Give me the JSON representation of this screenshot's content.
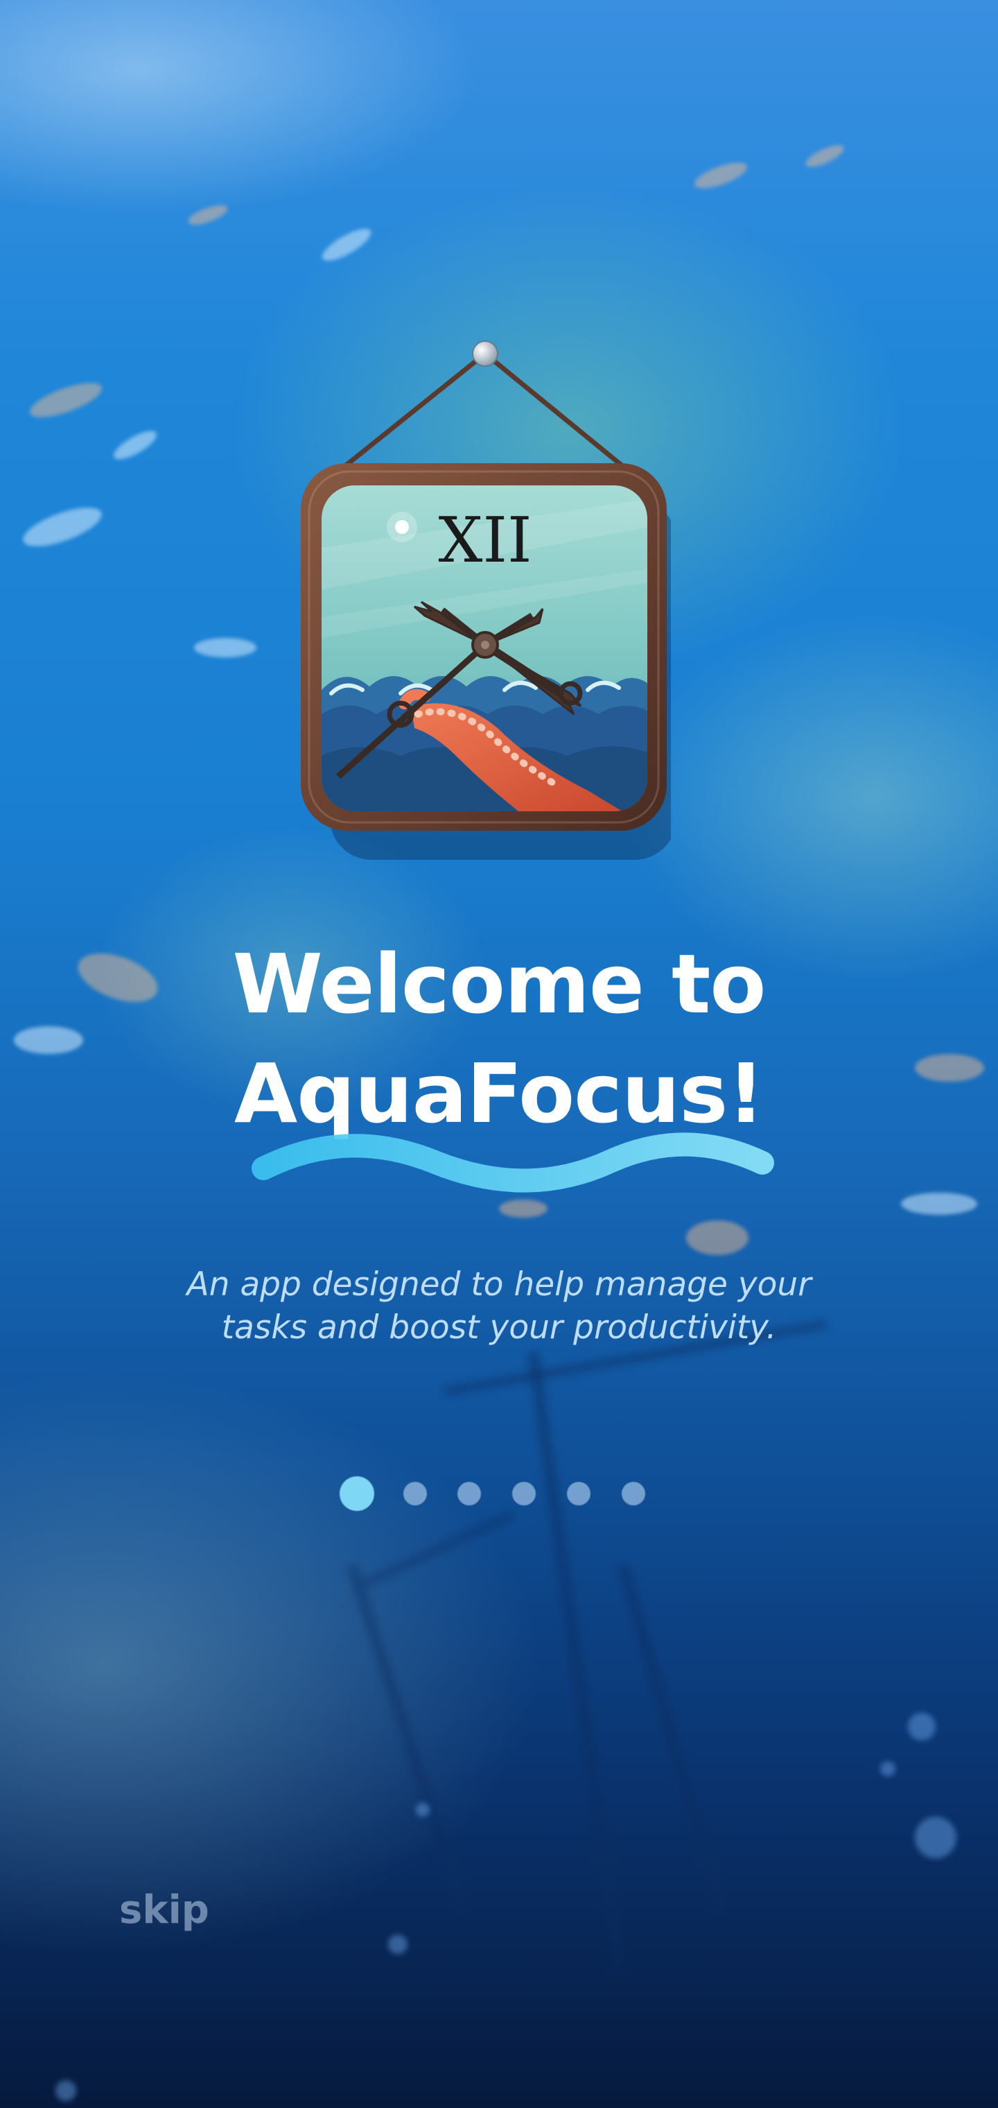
{
  "app": {
    "icon_name": "clock-frame-icon",
    "icon_numeral": "XII"
  },
  "welcome": {
    "title_line1": "Welcome to",
    "title_line2": "AquaFocus!",
    "subtitle_line1": "An app designed to help manage your",
    "subtitle_line2": "tasks and boost your productivity."
  },
  "pagination": {
    "total": 6,
    "active_index": 0
  },
  "actions": {
    "skip_label": "skip"
  },
  "colors": {
    "accent": "#7fd7f6",
    "title_text": "#ffffff",
    "subtitle_text": "#cde8ff",
    "wave": "#5fd8f8"
  }
}
